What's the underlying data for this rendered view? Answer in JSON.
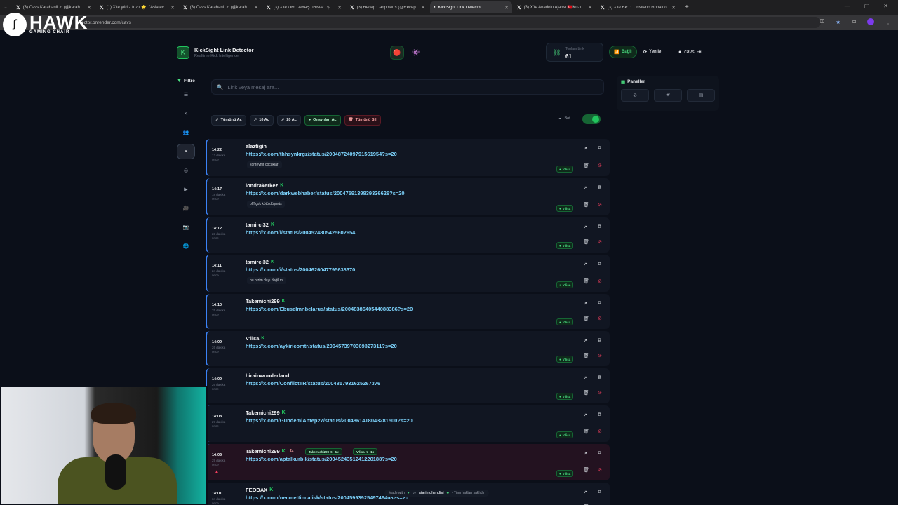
{
  "browser": {
    "tabs": [
      {
        "title": "(3) Cavs Karahanli ✓ (@karahan",
        "active": false
      },
      {
        "title": "(1) X'te yıldız tozu 🌟: \"Asla ev",
        "active": false
      },
      {
        "title": "(3) Cavs Karahanli ✓ (@karahan",
        "active": false
      },
      {
        "title": "(3) X'te ORC ARAŞTIRMA: \"Şİ",
        "active": false
      },
      {
        "title": "(3) Recep Canpolatrs (@Recep",
        "active": false
      },
      {
        "title": "KickSight Link Detector",
        "active": true
      },
      {
        "title": "(3) X'te Anadolu Ajansı 🇹🇷Kuzu",
        "active": false
      },
      {
        "title": "(3) X'te BPT: \"Cristiano Ronaldo",
        "active": false
      }
    ],
    "url": "ector.onrender.com/cavs"
  },
  "overlay": {
    "brand": "HAWK",
    "sub": "GAMING CHAIR"
  },
  "header": {
    "title": "KickSight Link Detector",
    "subtitle": "Realtime Kick Intelligence",
    "total_label": "Toplam Link",
    "total_value": "61",
    "connected_label": "Bağlı",
    "refresh_label": "Yenile",
    "user_label": "cavs"
  },
  "filter": {
    "title": "Filtre"
  },
  "search": {
    "placeholder": "Link veya mesaj ara..."
  },
  "actions": {
    "open_all": "Tümünü Aç",
    "open_10": "10 Aç",
    "open_20": "20 Aç",
    "open_approved": "Onaylıları Aç",
    "delete_all": "Tümünü Sil",
    "bot_label": "Bot"
  },
  "panels": {
    "title": "Paneller"
  },
  "badge_label": "V'lisa",
  "feed": [
    {
      "time": "14:22",
      "ago": "12 dakika önce",
      "user": "alaztigin",
      "kick": false,
      "link": "https://x.com/thhsynkrgz/status/2004872409791561954?s=20",
      "msg": "konteynır çocukları"
    },
    {
      "time": "14:17",
      "ago": "18 dakika önce",
      "user": "londrakerkez",
      "kick": true,
      "link": "https://x.com/darkwebhaber/status/2004759139839336626?s=20",
      "msg": "offf çok kötü düşmüş"
    },
    {
      "time": "14:12",
      "ago": "23 dakika önce",
      "user": "tamirci32",
      "kick": true,
      "link": "https://x.com/i/status/2004524805425602654",
      "msg": ""
    },
    {
      "time": "14:11",
      "ago": "24 dakika önce",
      "user": "tamirci32",
      "kick": true,
      "link": "https://x.com/i/status/2004626047795638370",
      "msg": "bu bizim dayı değil mi"
    },
    {
      "time": "14:10",
      "ago": "25 dakika önce",
      "user": "Takemichi299",
      "kick": true,
      "link": "https://x.com/Ebuselmnbelarus/status/2004838640544088386?s=20",
      "msg": ""
    },
    {
      "time": "14:09",
      "ago": "26 dakika önce",
      "user": "V'lisa",
      "kick": true,
      "link": "https://x.com/aykiricomtr/status/2004573970369327311?s=20",
      "msg": ""
    },
    {
      "time": "14:09",
      "ago": "26 dakika önce",
      "user": "hirainwonderland",
      "kick": false,
      "link": "https://x.com/ConflictTR/status/2004817931625267376",
      "msg": ""
    },
    {
      "time": "14:08",
      "ago": "27 dakika önce",
      "user": "Takemichi299",
      "kick": true,
      "link": "https://x.com/GundemiAntep27/status/2004861418043281500?s=20",
      "msg": ""
    },
    {
      "time": "14:06",
      "ago": "29 dakika önce",
      "user": "Takemichi299",
      "kick": true,
      "link": "https://x.com/aptalkurbik/status/2004524351241220188?s=20",
      "msg": "",
      "dup": "2x",
      "tags": [
        "Takemichi299 K · 1x",
        "V'lisa K · 1x"
      ],
      "warn": true
    },
    {
      "time": "14:01",
      "ago": "34 dakika önce",
      "user": "FEODAX",
      "kick": true,
      "link": "https://x.com/necmettincalisk/status/2004599392549746408?s=20",
      "msg": ""
    }
  ],
  "footer": {
    "made_with": "Made with",
    "by": "by",
    "author": "atarimuhendisi",
    "rights": "· Tüm hakları saklıdır"
  }
}
